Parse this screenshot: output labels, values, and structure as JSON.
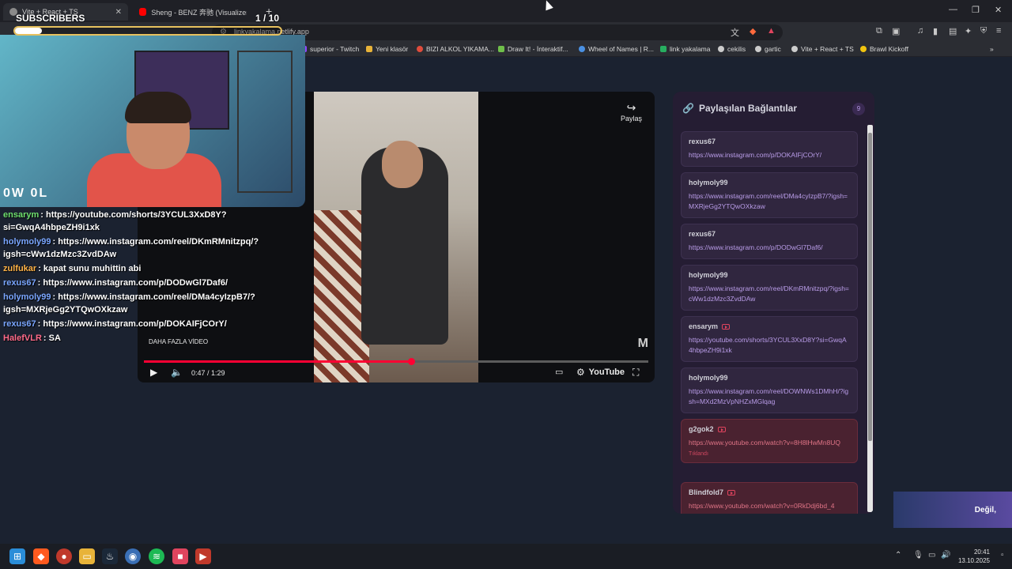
{
  "browser": {
    "tabs": [
      {
        "title": "Vite + React + TS",
        "favicon_color": "#8a8a8a"
      },
      {
        "title": "Sheng - BENZ 奔驰 (Visualizer) - You",
        "favicon_color": "#ff0000"
      }
    ],
    "url": "linkyakalama.netlify.app",
    "bookmarks": [
      {
        "label": "superior - Twitch",
        "color": "#9146ff"
      },
      {
        "label": "Yeni klasör",
        "color": "#e8b339"
      },
      {
        "label": "BIZI ALKOL YIKAMA...",
        "color": "#e04c3c"
      },
      {
        "label": "Draw It! - İnteraktif...",
        "color": "#6fbf4a"
      },
      {
        "label": "Wheel of Names | R...",
        "color": "#4a90e2"
      },
      {
        "label": "link yakalama",
        "color": "#27ae60"
      },
      {
        "label": "cekilis",
        "color": "#cccccc"
      },
      {
        "label": "gartic",
        "color": "#cccccc"
      },
      {
        "label": "Vite + React + TS",
        "color": "#cccccc"
      },
      {
        "label": "Brawl Kickoff",
        "color": "#f1c40f"
      }
    ]
  },
  "overlay": {
    "subscribers_label": "SUBSCRIBERS",
    "subscribers_count": "1 / 10",
    "subscribers_progress": 0.1,
    "cam_logo": "0W 0L"
  },
  "chat": [
    {
      "user": "ensarym",
      "user_color": "#6fe06f",
      "text": "https://youtube.com/shorts/3YCUL3XxD8Y?si=GwqA4hbpeZH9i1xk"
    },
    {
      "user": "holymoly99",
      "user_color": "#7aa6ff",
      "text": "https://www.instagram.com/reel/DKmRMnitzpq/?igsh=cWw1dzMzc3ZvdDAw"
    },
    {
      "user": "zulfukar",
      "user_color": "#ffb347",
      "text": "kapat sunu muhittin abi"
    },
    {
      "user": "rexus67",
      "user_color": "#7aa6ff",
      "text": "https://www.instagram.com/p/DODwGl7Daf6/"
    },
    {
      "user": "holymoly99",
      "user_color": "#7aa6ff",
      "text": "https://www.instagram.com/reel/DMa4cyIzpB7/?igsh=MXRjeGg2YTQwOXkzaw"
    },
    {
      "user": "rexus67",
      "user_color": "#7aa6ff",
      "text": "https://www.instagram.com/p/DOKAIFjCOrY/"
    },
    {
      "user": "HalefVLR",
      "user_color": "#ff6b8a",
      "text": "SA"
    }
  ],
  "player": {
    "share_label": "Paylaş",
    "more_videos": "DAHA FAZLA VİDEO",
    "current_time": "0:47",
    "duration": "1:29",
    "progress": 0.53,
    "brand": "YouTube"
  },
  "panel": {
    "title": "Paylaşılan Bağlantılar",
    "count": "9",
    "links": [
      {
        "user": "rexus67",
        "url": "https://www.instagram.com/p/DOKAIFjCOrY/",
        "youtube": false,
        "clicked": false,
        "status": ""
      },
      {
        "user": "holymoly99",
        "url": "https://www.instagram.com/reel/DMa4cyIzpB7/?igsh=MXRjeGg2YTQwOXkzaw",
        "youtube": false,
        "clicked": false,
        "status": ""
      },
      {
        "user": "rexus67",
        "url": "https://www.instagram.com/p/DODwGl7Daf6/",
        "youtube": false,
        "clicked": false,
        "status": ""
      },
      {
        "user": "holymoly99",
        "url": "https://www.instagram.com/reel/DKmRMnitzpq/?igsh=cWw1dzMzc3ZvdDAw",
        "youtube": false,
        "clicked": false,
        "status": ""
      },
      {
        "user": "ensarym",
        "url": "https://youtube.com/shorts/3YCUL3XxD8Y?si=GwqA4hbpeZH9i1xk",
        "youtube": true,
        "clicked": false,
        "status": ""
      },
      {
        "user": "holymoly99",
        "url": "https://www.instagram.com/reel/DOWNWs1DMhH/?igsh=MXd2MzVpNHZxMGlqag",
        "youtube": false,
        "clicked": false,
        "status": ""
      },
      {
        "user": "g2gok2",
        "url": "https://www.youtube.com/watch?v=8H8lHwMn8UQ",
        "youtube": true,
        "clicked": true,
        "status": "Tıklandı"
      },
      {
        "user": "Blindfold7",
        "url": "https://www.youtube.com/watch?v=0RkDdj6bd_4",
        "youtube": true,
        "clicked": true,
        "status": ""
      }
    ]
  },
  "corner_overlay": {
    "text": "Değil,"
  },
  "taskbar": {
    "time": "20:41",
    "date": "13.10.2025"
  }
}
